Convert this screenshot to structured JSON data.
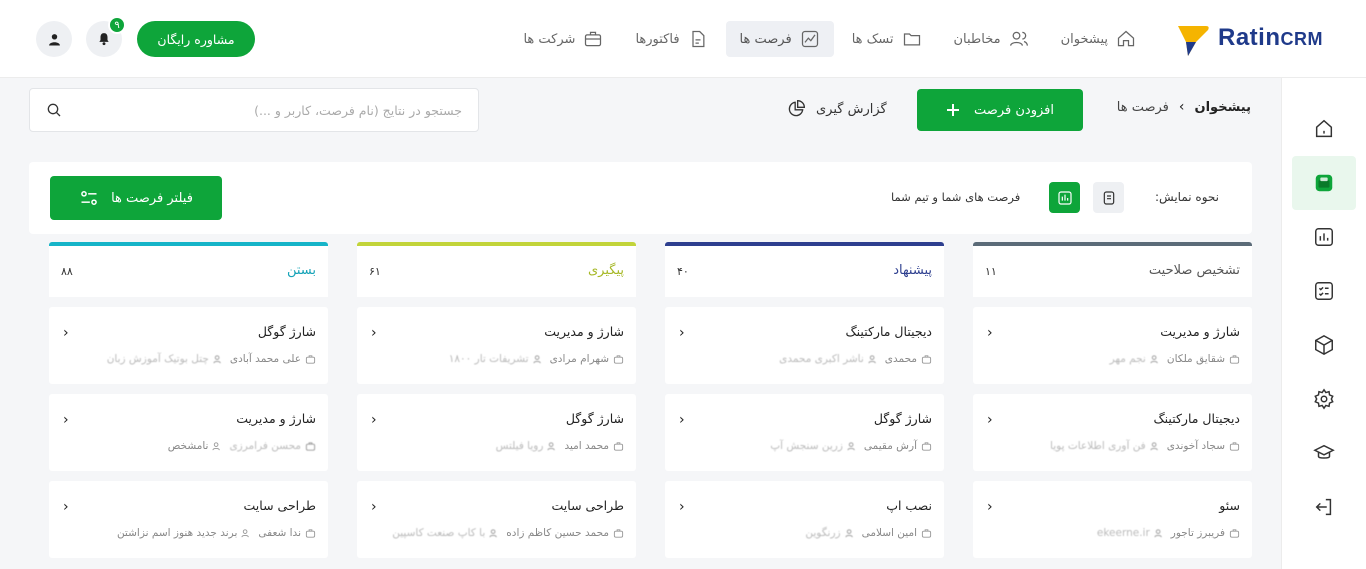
{
  "app": {
    "brand_main": "Ratin",
    "brand_sub": "CRM"
  },
  "nav": {
    "items": [
      {
        "label": "پیشخوان",
        "icon": "home-icon"
      },
      {
        "label": "مخاطبان",
        "icon": "users-icon"
      },
      {
        "label": "تسک ها",
        "icon": "folder-icon"
      },
      {
        "label": "فرصت ها",
        "icon": "opportunity-chart-icon",
        "active": true
      },
      {
        "label": "فاکتورها",
        "icon": "invoice-icon"
      },
      {
        "label": "شرکت ها",
        "icon": "briefcase-icon"
      }
    ]
  },
  "header": {
    "consult_label": "مشاوره رایگان",
    "notification_count": "۹"
  },
  "breadcrumb": {
    "home": "پیشخوان",
    "current": "فرصت ها"
  },
  "actions": {
    "add_label": "افزودن فرصت",
    "report_label": "گزارش گیری"
  },
  "search": {
    "placeholder": "جستجو در نتایج (نام فرصت، کاربر و ...)"
  },
  "filter_bar": {
    "view_label": "نحوه نمایش:",
    "scope_label": "فرصت های شما و تیم شما",
    "filter_label": "فیلتر فرصت ها"
  },
  "colors": {
    "accent": "#0ea53a",
    "col_qualification": "#5b6b78",
    "col_proposal": "#2e3f8f",
    "col_followup": "#c2d43a",
    "col_closed": "#16b4c8"
  },
  "columns": [
    {
      "title": "تشخیص صلاحیت",
      "count": "۱۱",
      "title_color": "#555555",
      "border_color": "#5b6b78",
      "cards": [
        {
          "title": "شارژ و مدیریت",
          "meta1": "شقایق ملکان",
          "meta2": "نجم مهر"
        },
        {
          "title": "دیجیتال مارکتینگ",
          "meta1": "سجاد آخوندی",
          "meta2": "فن آوری اطلاعات پویا"
        },
        {
          "title": "سئو",
          "meta1": "فریبرز تاجور",
          "meta2": "ekeerne.ir"
        }
      ]
    },
    {
      "title": "پیشنهاد",
      "count": "۴۰",
      "title_color": "#2e3f8f",
      "border_color": "#2e3f8f",
      "cards": [
        {
          "title": "دیجیتال مارکتینگ",
          "meta1": "محمدی",
          "meta2": "ناشر اکبری محمدی"
        },
        {
          "title": "شارژ گوگل",
          "meta1": "آرش مقیمی",
          "meta2": "زرین سنجش آپ"
        },
        {
          "title": "نصب اپ",
          "meta1": "امین اسلامی",
          "meta2": "زرنگوین"
        }
      ]
    },
    {
      "title": "پیگیری",
      "count": "۶۱",
      "title_color": "#a6b826",
      "border_color": "#c2d43a",
      "cards": [
        {
          "title": "شارژ و مدیریت",
          "meta1": "شهرام مرادی",
          "meta2": "تشریفات تار ۱۸۰۰"
        },
        {
          "title": "شارژ گوگل",
          "meta1": "محمد امید",
          "meta2": "رویا فیلتس"
        },
        {
          "title": "طراحی سایت",
          "meta1": "محمد حسین کاظم زاده",
          "meta2": "با کاپ صنعت کاسپین"
        }
      ]
    },
    {
      "title": "بستن",
      "count": "۸۸",
      "title_color": "#16a3b8",
      "border_color": "#16b4c8",
      "cards": [
        {
          "title": "شارژ گوگل",
          "meta1": "علی محمد آبادی",
          "meta2": "چتل بوتیک آموزش زبان"
        },
        {
          "title": "شارژ و مدیریت",
          "meta1": "محسن فرامرزی",
          "meta2": "نامشخص"
        },
        {
          "title": "طراحی سایت",
          "meta1": "ندا شعفی",
          "meta2": "برند جدید هنوز اسم نزاشتن"
        }
      ]
    }
  ]
}
